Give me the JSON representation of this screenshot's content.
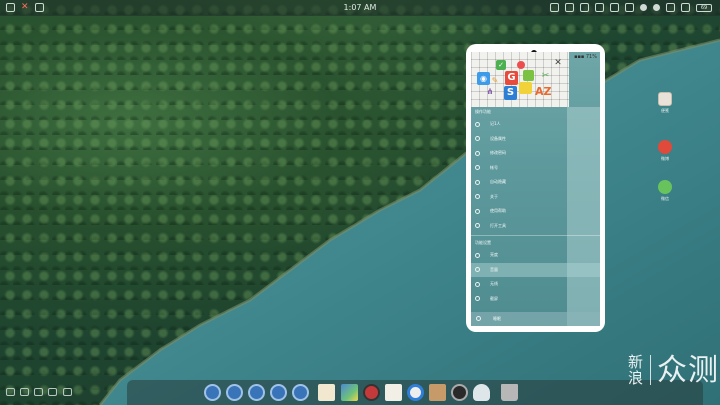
{
  "status_bar": {
    "clock": "1:07 AM",
    "battery_label": "69",
    "left_icons": [
      "apps-icon",
      "close-icon",
      "screen-icon"
    ],
    "right_icons": [
      "window-icon",
      "camera-icon",
      "mail-icon",
      "keyboard-icon",
      "screen-icon",
      "cast-icon",
      "clock-icon",
      "wifi-icon",
      "signal-icon",
      "signal-icon",
      "battery-icon"
    ]
  },
  "phone": {
    "status_text": "▪▪▪ 71%",
    "menu_header": "操作功能",
    "menu_items": [
      {
        "label": "记1人",
        "icon": "item-icon"
      },
      {
        "label": "设备属性",
        "icon": "item-icon"
      },
      {
        "label": "修改密码",
        "icon": "item-icon"
      },
      {
        "label": "帐号",
        "icon": "item-icon"
      },
      {
        "label": "自动隐藏",
        "icon": "item-icon"
      },
      {
        "label": "关于",
        "icon": "item-icon"
      },
      {
        "label": "使用帮助",
        "icon": "item-icon"
      },
      {
        "label": "打开工具",
        "icon": "item-icon"
      }
    ],
    "section_header": "功能设置",
    "section_items": [
      {
        "label": "亮度",
        "icon": "brightness-icon",
        "selected": false
      },
      {
        "label": "音量",
        "icon": "volume-icon",
        "selected": true
      },
      {
        "label": "无线",
        "icon": "wifi-icon",
        "selected": false
      },
      {
        "label": "截屏",
        "icon": "screenshot-icon",
        "selected": false
      }
    ],
    "bottom_label": "睡眠"
  },
  "desktop_icons": [
    {
      "label": "便笺",
      "icon": "note-icon"
    },
    {
      "label": "微博",
      "icon": "weibo-icon"
    },
    {
      "label": "微信",
      "icon": "wechat-icon"
    }
  ],
  "dock": {
    "items": [
      "app-icon",
      "app-icon",
      "app-icon",
      "app-icon",
      "app-icon",
      "document-icon",
      "image-icon",
      "red-app-icon",
      "note-icon",
      "ring-icon",
      "box-icon",
      "plane-icon",
      "cloud-icon",
      "trash-icon"
    ]
  },
  "watermark": {
    "small_top": "新",
    "small_bottom": "浪",
    "big": "众测"
  }
}
